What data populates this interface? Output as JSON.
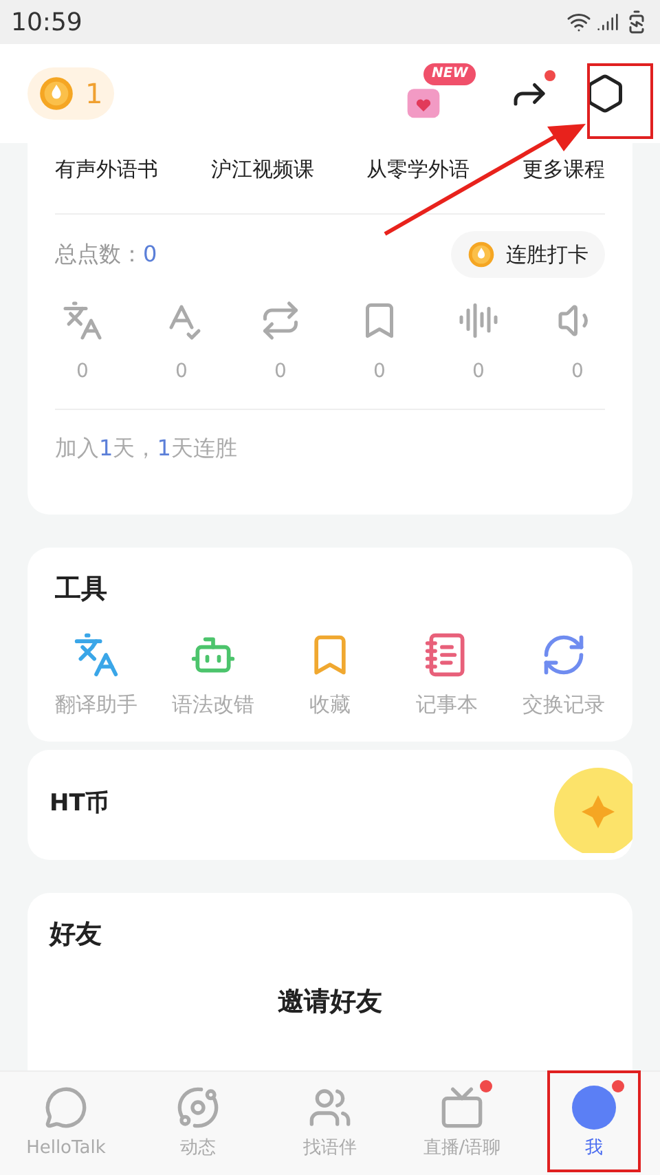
{
  "status_bar": {
    "time": "10:59"
  },
  "header": {
    "coins": "1",
    "gift_badge": "NEW",
    "share_dot": true
  },
  "courses": [
    "有声外语书",
    "沪江视频课",
    "从零学外语",
    "更多课程"
  ],
  "points": {
    "label": "总点数：",
    "value": "0",
    "checkin": "连胜打卡"
  },
  "stats": [
    {
      "kind": "translate",
      "value": "0"
    },
    {
      "kind": "spell",
      "value": "0"
    },
    {
      "kind": "repeat",
      "value": "0"
    },
    {
      "kind": "bookmark",
      "value": "0"
    },
    {
      "kind": "tts",
      "value": "0"
    },
    {
      "kind": "sound",
      "value": "0"
    }
  ],
  "streak": [
    {
      "text": "加入",
      "accent": false
    },
    {
      "text": "1",
      "accent": true
    },
    {
      "text": "天，",
      "accent": false
    },
    {
      "text": "1",
      "accent": true
    },
    {
      "text": "天连胜",
      "accent": false
    }
  ],
  "tools": {
    "title": "工具",
    "items": [
      {
        "kind": "translate",
        "label": "翻译助手",
        "color": "#3aa6e8"
      },
      {
        "kind": "robot",
        "label": "语法改错",
        "color": "#4cc46c"
      },
      {
        "kind": "favorite",
        "label": "收藏",
        "color": "#f0a830"
      },
      {
        "kind": "note",
        "label": "记事本",
        "color": "#e8607a"
      },
      {
        "kind": "exchange",
        "label": "交换记录",
        "color": "#6f8cf0"
      }
    ]
  },
  "ht_coin": {
    "title": "HT币"
  },
  "friends": {
    "title": "好友",
    "invite": "邀请好友"
  },
  "nav": [
    {
      "kind": "chat",
      "label": "HelloTalk",
      "selected": false,
      "dot": false
    },
    {
      "kind": "planet",
      "label": "动态",
      "selected": false,
      "dot": false
    },
    {
      "kind": "partners",
      "label": "找语伴",
      "selected": false,
      "dot": false
    },
    {
      "kind": "live",
      "label": "直播/语聊",
      "selected": false,
      "dot": true
    },
    {
      "kind": "me",
      "label": "我",
      "selected": true,
      "dot": true
    }
  ]
}
